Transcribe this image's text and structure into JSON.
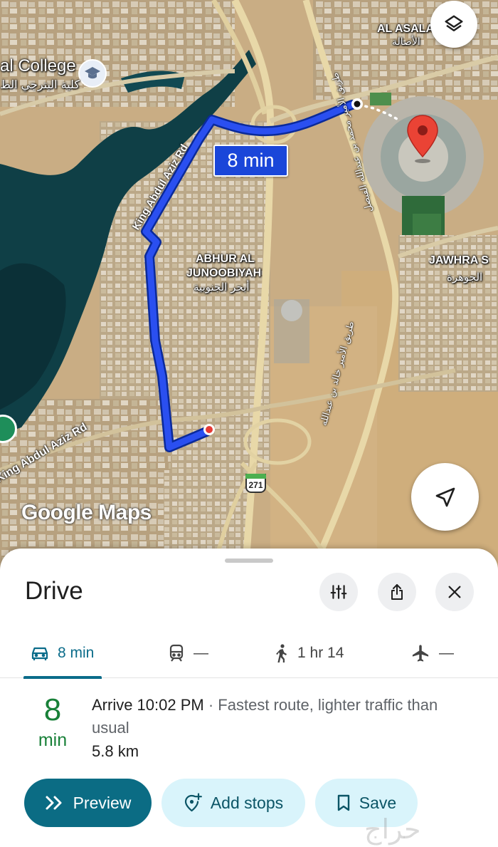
{
  "map": {
    "route_time_chip": "8 min",
    "logo": "Google Maps",
    "highway_shield": "271",
    "labels": [
      {
        "id": "college_en",
        "text": "al College"
      },
      {
        "id": "college_ar",
        "text": "كلية البترجي الط"
      },
      {
        "id": "al_asala_en",
        "text": "AL ASALA"
      },
      {
        "id": "al_asala_ar",
        "text": "الأصالة"
      },
      {
        "id": "abhur_1",
        "text": "ABHUR AL"
      },
      {
        "id": "abhur_2",
        "text": "JUNOOBIYAH"
      },
      {
        "id": "abhur_ar",
        "text": "أبحر الجنوبية"
      },
      {
        "id": "jawhra_en",
        "text": "JAWHRA S"
      },
      {
        "id": "jawhra_ar",
        "text": "الجوهرة"
      }
    ],
    "roads": {
      "king_abdul_aziz_upper": "King Abdul Aziz Rd",
      "king_abdul_aziz_lower": "King Abdul Aziz Rd",
      "prince_road_1": "طريق الأمير محمد بن عبدالله الفيصل",
      "prince_road_2": "طريق الأمير خالد بن عبدالله"
    },
    "icons": {
      "layers": "layers-icon",
      "locate": "navigation-arrow-icon",
      "destination": "red-pin-icon",
      "school": "graduation-cap-icon"
    }
  },
  "sheet": {
    "title": "Drive",
    "modes": [
      {
        "icon": "car-icon",
        "label": "8 min",
        "active": true
      },
      {
        "icon": "train-icon",
        "label": "—"
      },
      {
        "icon": "walk-icon",
        "label": "1 hr 14"
      },
      {
        "icon": "plane-icon",
        "label": "—"
      }
    ],
    "route": {
      "eta_value": "8",
      "eta_unit": "min",
      "arrive": "Arrive 10:02 PM",
      "separator": " · ",
      "note": "Fastest route, lighter traffic than usual",
      "distance": "5.8 km"
    },
    "actions": {
      "preview": "Preview",
      "add_stops": "Add stops",
      "save": "Save"
    },
    "watermark": "حراج"
  },
  "colors": {
    "route": "#1a46d9",
    "accent": "#0b6c84",
    "eta_green": "#188038",
    "pill_bg": "#d9f4fb"
  }
}
